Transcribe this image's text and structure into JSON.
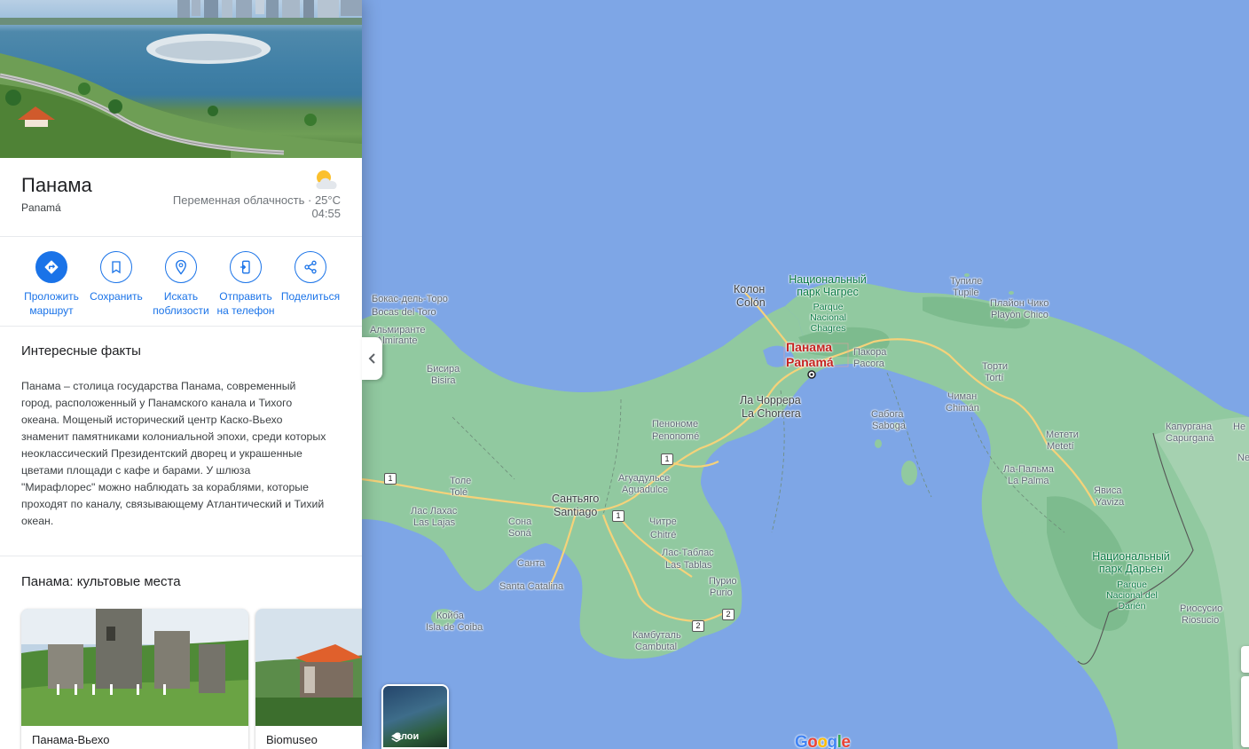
{
  "place": {
    "title": "Панама",
    "subtitle": "Panamá",
    "weather": "Переменная облачность · 25°C",
    "time": "04:55",
    "weather_icon": "partly-cloudy-icon"
  },
  "actions": [
    {
      "label": "Проложить маршрут",
      "icon": "directions-icon"
    },
    {
      "label": "Сохранить",
      "icon": "bookmark-icon"
    },
    {
      "label": "Искать поблизости",
      "icon": "nearby-icon"
    },
    {
      "label": "Отправить на телефон",
      "icon": "send-to-phone-icon"
    },
    {
      "label": "Поделиться",
      "icon": "share-icon"
    }
  ],
  "facts": {
    "title": "Интересные факты",
    "text": "Панама – столица государства Панама, современный город, расположенный у Панамского канала и Тихого океана. Мощеный исторический центр Каско-Вьехо знаменит памятниками колониальной эпохи, среди которых неоклассический Президентский дворец и украшенные цветами площади с кафе и барами. У шлюза \"Мирафлорес\" можно наблюдать за кораблями, которые проходят по каналу, связывающему Атлантический и Тихий океан."
  },
  "landmarks": {
    "title": "Панама: культовые места",
    "items": [
      {
        "name": "Панама-Вьехо"
      },
      {
        "name": "Biomuseo"
      }
    ]
  },
  "map": {
    "layers_label": "Слои",
    "google_logo": "Google",
    "colors": {
      "water": "#7ea6e6",
      "land": "#91c9a0",
      "road": "#f5d27a",
      "capital": "#c5221f",
      "park": "#0a7a44"
    },
    "labels": {
      "bocas_ru": "Бокас-дель-Торо",
      "bocas": "Bocas del Toro",
      "almirante_ru": "Альмиранте",
      "almirante": "Almirante",
      "bisira_ru": "Бисира",
      "bisira": "Bisira",
      "colon_ru": "Колон",
      "colon": "Colón",
      "chagres_ru": "Национальный парк Чагрес",
      "chagres": "Parque Nacional Chagres",
      "panama_ru": "Панама",
      "panama": "Panamá",
      "pacora_ru": "Пакора",
      "pacora": "Pacora",
      "chorrera_ru": "Ла Чоррера",
      "chorrera": "La Chorrera",
      "penonome_ru": "Пенономе",
      "penonome": "Penonomé",
      "aguadulce_ru": "Агуадульсе",
      "aguadulce": "Aguadulce",
      "santiago_ru": "Сантьяго",
      "santiago": "Santiago",
      "tole_ru": "Толе",
      "tole": "Tolé",
      "laslajas_ru": "Лас Лахас",
      "laslajas": "Las Lajas",
      "sona_ru": "Сона",
      "sona": "Soná",
      "chitre_ru": "Читре",
      "chitre": "Chitré",
      "lastablas_ru": "Лас-Таблас",
      "lastablas": "Las Tablas",
      "purio_ru": "Пурио",
      "purio": "Purio",
      "santacatalina_ru": "Санта",
      "santacatalina": "Santa Catalina",
      "coiba_ru": "Койба",
      "coiba": "Isla de Coiba",
      "cambutal_ru": "Камбуталь",
      "cambutal": "Cambutal",
      "saboga_ru": "Сабога",
      "saboga": "Saboga",
      "tupile_ru": "Тупиле",
      "tupile": "Tupile",
      "playon_ru": "Плайон Чико",
      "playon": "Playón Chico",
      "torti_ru": "Торти",
      "torti": "Tortí",
      "chiman_ru": "Чиман",
      "chiman": "Chimán",
      "meteti_ru": "Метети",
      "meteti": "Metetí",
      "lapalma_ru": "Ла-Пальма",
      "lapalma": "La Palma",
      "yaviza_ru": "Явиса",
      "yaviza": "Yaviza",
      "capurgana_ru": "Капургана",
      "capurgana": "Capurganá",
      "darien_ru": "Национальный парк Дарьен",
      "darien": "Parque Nacional del Darién",
      "riosucio_ru": "Риосусио",
      "riosucio": "Riosucio",
      "ne_ru": "Не",
      "ne": "Ne"
    },
    "shields": [
      "1",
      "1",
      "1",
      "2",
      "2"
    ]
  }
}
